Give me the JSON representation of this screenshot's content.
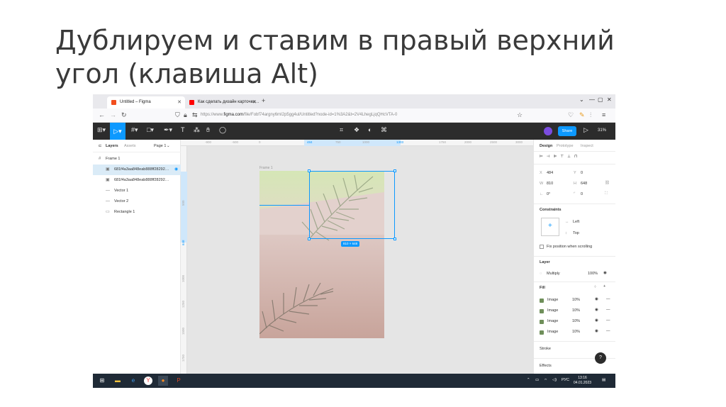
{
  "slide": {
    "title": "Дублируем и ставим в правый верхний угол (клавиша Alt)"
  },
  "browser": {
    "tabs": [
      {
        "label": "Untitled – Figma",
        "active": true
      },
      {
        "label": "Как сделать дизайн карточки…",
        "active": false
      }
    ],
    "url_prefix": "https://www.",
    "url_domain": "figma.com",
    "url_rest": "/file/Fobf74argny6mI2p5gg4ul/Untitled?node-id=1%3A2&t=2V4LhegLjqQHcVTA-0"
  },
  "toolbar": {
    "share_label": "Share",
    "zoom": "31%"
  },
  "layers_panel": {
    "tab_layers": "Layers",
    "tab_assets": "Assets",
    "page": "Page 1",
    "items": [
      {
        "label": "Frame 1",
        "icon": "#",
        "indent": 0,
        "selected": false
      },
      {
        "label": "681f4a3aa848eab888ff28292…",
        "icon": "▣",
        "indent": 1,
        "selected": true
      },
      {
        "label": "681f4a3aa848eab888ff28292…",
        "icon": "▣",
        "indent": 1,
        "selected": false
      },
      {
        "label": "Vector 1",
        "icon": "—",
        "indent": 1,
        "selected": false
      },
      {
        "label": "Vector 2",
        "icon": "—",
        "indent": 1,
        "selected": false
      },
      {
        "label": "Rectangle 1",
        "icon": "▭",
        "indent": 1,
        "selected": false
      }
    ]
  },
  "canvas": {
    "frame_label": "Frame 1",
    "size_badge": "810 × 648",
    "ruler_top": [
      "-900",
      "-500",
      "0",
      "",
      "484",
      "750",
      "1000",
      "1303",
      "1750",
      "2000",
      "2500",
      "3000"
    ],
    "ruler_left": [
      "500",
      "648",
      "1000",
      "1250",
      "1500",
      "1750"
    ]
  },
  "design_panel": {
    "tabs": [
      "Design",
      "Prototype",
      "Inspect"
    ],
    "x_label": "X",
    "x": "484",
    "y_label": "Y",
    "y": "0",
    "w_label": "W",
    "w": "810",
    "h_label": "H",
    "h": "648",
    "rotation": "0°",
    "radius": "0",
    "constraints_title": "Constraints",
    "constraint_h": "Left",
    "constraint_v": "Top",
    "fix_position": "Fix position when scrolling",
    "layer_title": "Layer",
    "blend_mode": "Multiply",
    "layer_opacity": "100%",
    "fill_title": "Fill",
    "fills": [
      {
        "name": "Image",
        "opacity": "10%"
      },
      {
        "name": "Image",
        "opacity": "10%"
      },
      {
        "name": "Image",
        "opacity": "10%"
      },
      {
        "name": "Image",
        "opacity": "10%"
      }
    ],
    "stroke_title": "Stroke",
    "effects_title": "Effects"
  },
  "taskbar": {
    "lang": "РУС",
    "time": "13:16",
    "date": "04.01.2023"
  }
}
